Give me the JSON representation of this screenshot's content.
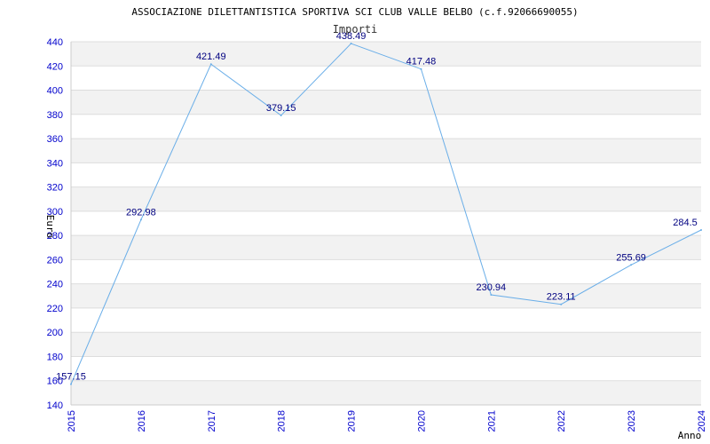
{
  "chart_data": {
    "type": "line",
    "title": "ASSOCIAZIONE DILETTANTISTICA SPORTIVA SCI CLUB VALLE BELBO (c.f.92066690055)",
    "subtitle": "Importi",
    "xlabel": "Anno",
    "ylabel": "Euro",
    "x": [
      "2015",
      "2016",
      "2017",
      "2018",
      "2019",
      "2020",
      "2021",
      "2022",
      "2023",
      "2024"
    ],
    "values": [
      157.15,
      292.98,
      421.49,
      379.15,
      438.49,
      417.48,
      230.94,
      223.11,
      255.69,
      284.5
    ],
    "value_labels": [
      "157.15",
      "292.98",
      "421.49",
      "379.15",
      "438.49",
      "417.48",
      "230.94",
      "223.11",
      "255.69",
      "284.5"
    ],
    "ylim": [
      140,
      440
    ],
    "yticks": [
      "140",
      "160",
      "180",
      "200",
      "220",
      "240",
      "260",
      "280",
      "300",
      "320",
      "340",
      "360",
      "380",
      "400",
      "420",
      "440"
    ],
    "grid": true,
    "colors": {
      "line": "#6aaee8",
      "tick_label": "#0000cc",
      "data_label": "#000080",
      "band": "#f2f2f2",
      "grid": "#dddddd",
      "axis": "#cccccc"
    }
  }
}
